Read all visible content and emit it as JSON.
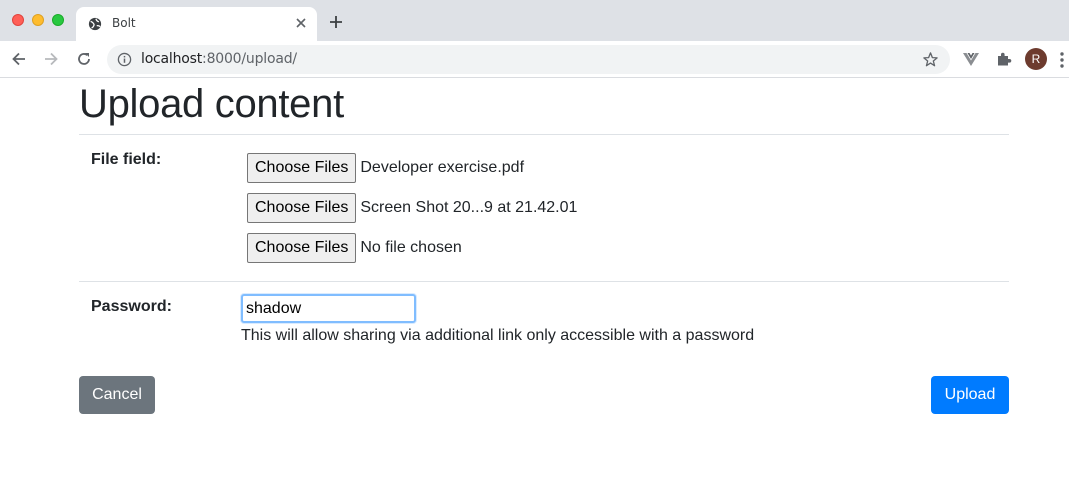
{
  "browser": {
    "tab": {
      "title": "Bolt"
    },
    "address_bar": {
      "host": "localhost",
      "path": ":8000/upload/"
    },
    "profile_initial": "R"
  },
  "page": {
    "title": "Upload content",
    "file_field": {
      "label": "File field:",
      "inputs": [
        {
          "button_label": "Choose Files",
          "file_name": "Developer exercise.pdf"
        },
        {
          "button_label": "Choose Files",
          "file_name": "Screen Shot 20...9 at 21.42.01"
        },
        {
          "button_label": "Choose Files",
          "file_name": "No file chosen"
        }
      ]
    },
    "password": {
      "label": "Password:",
      "value": "shadow",
      "help": "This will allow sharing via additional link only accessible with a password"
    },
    "actions": {
      "cancel_label": "Cancel",
      "upload_label": "Upload",
      "cancel_color": "#6c757d",
      "upload_color": "#007bff"
    }
  },
  "icons": [
    "globe-icon",
    "close-icon",
    "plus-icon",
    "back-arrow-icon",
    "forward-arrow-icon",
    "reload-icon",
    "info-icon",
    "star-icon",
    "vue-devtools-icon",
    "extensions-icon",
    "menu-icon"
  ]
}
